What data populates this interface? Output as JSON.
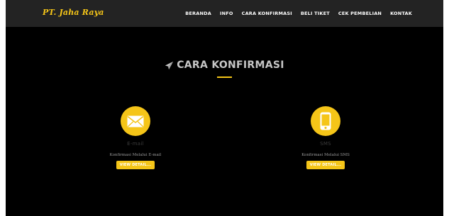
{
  "brand": "PT. Jaha Raya",
  "nav": [
    "BERANDA",
    "INFO",
    "CARA KONFIRMASI",
    "BELI TIKET",
    "CEK PEMBELIAN",
    "KONTAK"
  ],
  "section": {
    "title": "CARA KONFIRMASI",
    "icon": "paper-plane-icon"
  },
  "methods": [
    {
      "name": "E-mail",
      "description": "Konfirmasi Melalui E-mail",
      "button": "VIEW DETAIL...",
      "icon": "envelope-icon"
    },
    {
      "name": "SMS",
      "description": "Konfirmasi Melalui SMS",
      "button": "VIEW DETAIL...",
      "icon": "phone-icon"
    }
  ],
  "colors": {
    "accent": "#f5c518",
    "navbar": "#232323",
    "background": "#000000"
  }
}
